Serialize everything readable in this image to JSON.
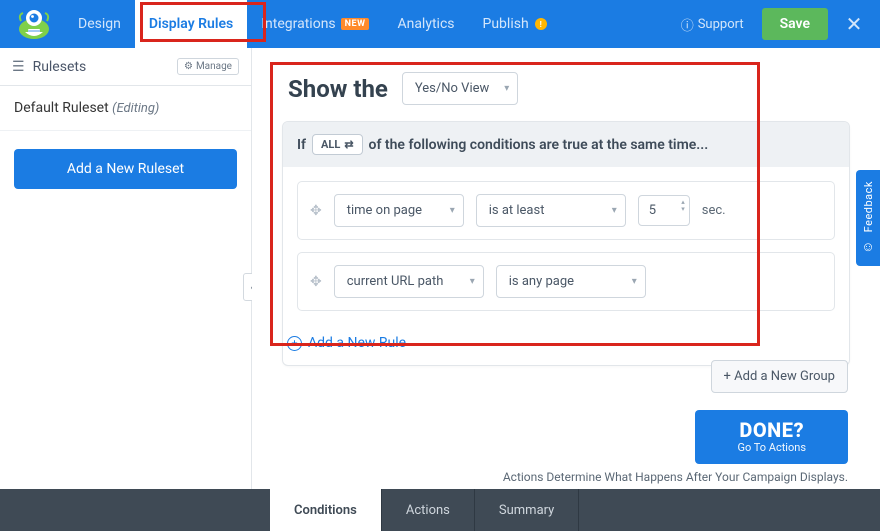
{
  "nav": {
    "design": "Design",
    "display_rules": "Display Rules",
    "integrations": "Integrations",
    "integrations_badge": "NEW",
    "analytics": "Analytics",
    "publish": "Publish",
    "publish_badge": "!"
  },
  "top": {
    "support": "Support",
    "save": "Save"
  },
  "sidebar": {
    "title": "Rulesets",
    "manage": "Manage",
    "default_ruleset": "Default Ruleset",
    "editing": "(Editing)",
    "add_new_ruleset": "Add a New Ruleset"
  },
  "main": {
    "show_the": "Show the",
    "view_select": "Yes/No View",
    "if": "If",
    "all": "ALL",
    "cond_suffix": "of the following conditions are true at the same time...",
    "rule1_field": "time on page",
    "rule1_op": "is at least",
    "rule1_value": "5",
    "rule1_unit": "sec.",
    "rule2_field": "current URL path",
    "rule2_op": "is any page",
    "add_rule": "Add a New Rule",
    "add_group": "+ Add a New Group",
    "done_title": "DONE?",
    "done_sub": "Go To Actions",
    "actions_note": "Actions Determine What Happens After Your Campaign Displays."
  },
  "tabs": {
    "conditions": "Conditions",
    "actions": "Actions",
    "summary": "Summary"
  },
  "feedback": "Feedback"
}
